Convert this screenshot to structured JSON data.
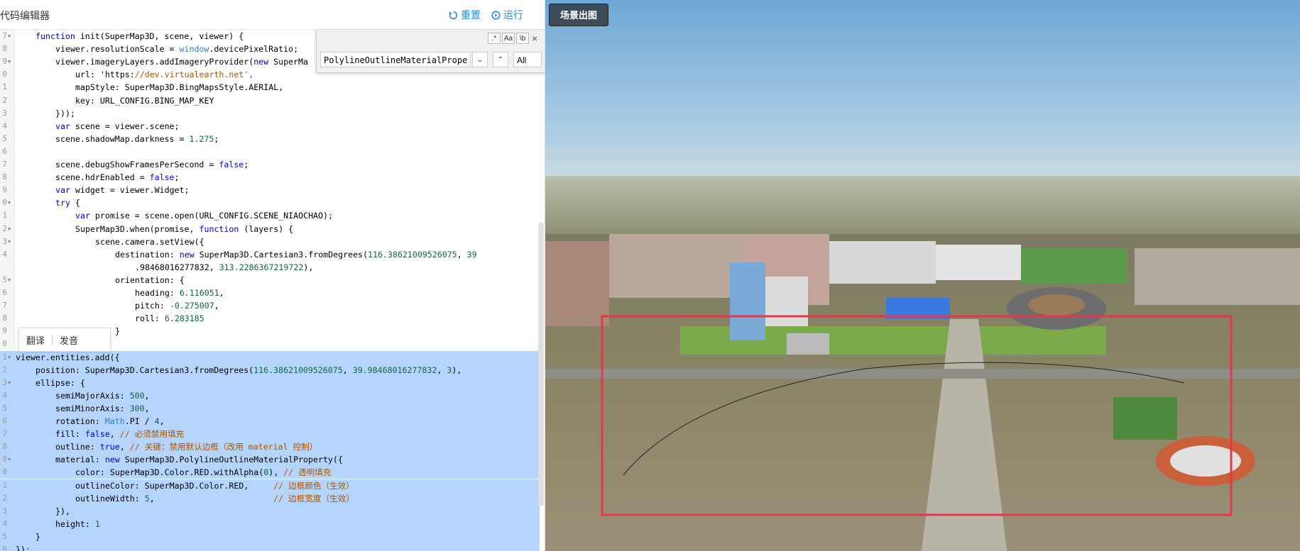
{
  "header": {
    "title": "代码编辑器",
    "reset_label": "重置",
    "run_label": "运行"
  },
  "find": {
    "search_value": "PolylineOutlineMaterialPrope",
    "opt_regex": ".*",
    "opt_case": "Aa",
    "opt_word": "\\b",
    "all_label": "All",
    "close": "×"
  },
  "tooltip": {
    "translate": "翻译",
    "pronounce": "发音"
  },
  "map": {
    "scene_button_label": "场景出图",
    "ellipse_color": "#e8364a"
  },
  "code_lines": [
    {
      "n": "7",
      "f": true,
      "i": 1,
      "t": "function init(SuperMap3D, scene, viewer) {"
    },
    {
      "n": "8",
      "f": false,
      "i": 2,
      "t": "viewer.resolutionScale = window.devicePixelRatio;"
    },
    {
      "n": "9",
      "f": true,
      "i": 2,
      "t": "viewer.imageryLayers.addImageryProvider(new SuperMa"
    },
    {
      "n": "0",
      "f": false,
      "i": 3,
      "t": "url: 'https://dev.virtualearth.net',"
    },
    {
      "n": "1",
      "f": false,
      "i": 3,
      "t": "mapStyle: SuperMap3D.BingMapsStyle.AERIAL,"
    },
    {
      "n": "2",
      "f": false,
      "i": 3,
      "t": "key: URL_CONFIG.BING_MAP_KEY"
    },
    {
      "n": "3",
      "f": false,
      "i": 2,
      "t": "}));"
    },
    {
      "n": "4",
      "f": false,
      "i": 2,
      "t": "var scene = viewer.scene;"
    },
    {
      "n": "5",
      "f": false,
      "i": 2,
      "t": "scene.shadowMap.darkness = 1.275;"
    },
    {
      "n": "6",
      "f": false,
      "i": 0,
      "t": ""
    },
    {
      "n": "7",
      "f": false,
      "i": 2,
      "t": "scene.debugShowFramesPerSecond = false;"
    },
    {
      "n": "8",
      "f": false,
      "i": 2,
      "t": "scene.hdrEnabled = false;"
    },
    {
      "n": "9",
      "f": false,
      "i": 2,
      "t": "var widget = viewer.Widget;"
    },
    {
      "n": "0",
      "f": true,
      "i": 2,
      "t": "try {"
    },
    {
      "n": "1",
      "f": false,
      "i": 3,
      "t": "var promise = scene.open(URL_CONFIG.SCENE_NIAOCHAO);"
    },
    {
      "n": "2",
      "f": true,
      "i": 3,
      "t": "SuperMap3D.when(promise, function (layers) {"
    },
    {
      "n": "3",
      "f": true,
      "i": 4,
      "t": "scene.camera.setView({"
    },
    {
      "n": "4",
      "f": false,
      "i": 5,
      "t": "destination: new SuperMap3D.Cartesian3.fromDegrees(116.38621009526075, 39"
    },
    {
      "n": "",
      "f": false,
      "i": 6,
      "t": ".98468016277832, 313.2286367219722),"
    },
    {
      "n": "5",
      "f": true,
      "i": 5,
      "t": "orientation: {"
    },
    {
      "n": "6",
      "f": false,
      "i": 6,
      "t": "heading: 6.116051,"
    },
    {
      "n": "7",
      "f": false,
      "i": 6,
      "t": "pitch: -0.275007,"
    },
    {
      "n": "8",
      "f": false,
      "i": 6,
      "t": "roll: 6.283185"
    },
    {
      "n": "9",
      "f": false,
      "i": 5,
      "t": "}"
    },
    {
      "n": "0",
      "f": false,
      "i": 4,
      "t": "});"
    },
    {
      "n": "1",
      "f": true,
      "i": 0,
      "t": "viewer.entities.add({",
      "s": true
    },
    {
      "n": "2",
      "f": false,
      "i": 1,
      "t": "position: SuperMap3D.Cartesian3.fromDegrees(116.38621009526075, 39.98468016277832, 3),",
      "s": true
    },
    {
      "n": "3",
      "f": true,
      "i": 1,
      "t": "ellipse: {",
      "s": true
    },
    {
      "n": "4",
      "f": false,
      "i": 2,
      "t": "semiMajorAxis: 500,",
      "s": true
    },
    {
      "n": "5",
      "f": false,
      "i": 2,
      "t": "semiMinorAxis: 300,",
      "s": true
    },
    {
      "n": "6",
      "f": false,
      "i": 2,
      "t": "rotation: Math.PI / 4,",
      "s": true
    },
    {
      "n": "7",
      "f": false,
      "i": 2,
      "t": "fill: false, // 必须禁用填充",
      "s": true
    },
    {
      "n": "8",
      "f": false,
      "i": 2,
      "t": "outline: true, // 关键：禁用默认边框（改用 material 控制）",
      "s": true
    },
    {
      "n": "9",
      "f": true,
      "i": 2,
      "t": "material: new SuperMap3D.PolylineOutlineMaterialProperty({",
      "s": true
    },
    {
      "n": "0",
      "f": false,
      "i": 3,
      "t": "color: SuperMap3D.Color.RED.withAlpha(0), // 透明填充",
      "s": true
    },
    {
      "n": "1",
      "f": false,
      "i": 3,
      "t": "outlineColor: SuperMap3D.Color.RED,     // 边框颜色（生效）",
      "s": true
    },
    {
      "n": "2",
      "f": false,
      "i": 3,
      "t": "outlineWidth: 5,                        // 边框宽度（生效）",
      "s": true
    },
    {
      "n": "3",
      "f": false,
      "i": 2,
      "t": "}),",
      "s": true
    },
    {
      "n": "4",
      "f": false,
      "i": 2,
      "t": "height: 1",
      "s": true
    },
    {
      "n": "5",
      "f": false,
      "i": 1,
      "t": "}",
      "s": true
    },
    {
      "n": "6",
      "f": false,
      "i": 0,
      "t": "});",
      "s": true
    }
  ]
}
